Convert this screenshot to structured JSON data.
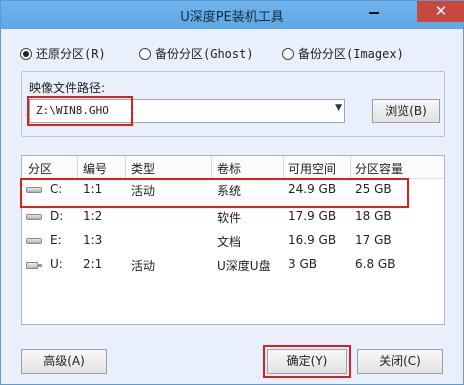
{
  "window": {
    "title": "U深度PE装机工具",
    "minimize_label": "—",
    "close_label": "✕"
  },
  "radios": [
    {
      "label": "还原分区(R)",
      "selected": true
    },
    {
      "label": "备份分区(Ghost)",
      "selected": false
    },
    {
      "label": "备份分区(Imagex)",
      "selected": false
    }
  ],
  "image_path": {
    "label": "映像文件路径:",
    "value": "Z:\\WIN8.GHO",
    "dropdown_icon": "chevron-down-icon",
    "browse_label": "浏览(B)"
  },
  "table": {
    "headers": [
      "分区",
      "编号",
      "类型",
      "卷标",
      "可用空间",
      "分区容量"
    ],
    "rows": [
      {
        "drive": "C:",
        "num": "1:1",
        "type": "活动",
        "label": "系统",
        "free": "24.9 GB",
        "size": "25 GB",
        "icon": "hard-drive-icon"
      },
      {
        "drive": "D:",
        "num": "1:2",
        "type": "",
        "label": "软件",
        "free": "17.9 GB",
        "size": "18 GB",
        "icon": "hard-drive-icon"
      },
      {
        "drive": "E:",
        "num": "1:3",
        "type": "",
        "label": "文档",
        "free": "16.9 GB",
        "size": "17 GB",
        "icon": "hard-drive-icon"
      },
      {
        "drive": "U:",
        "num": "2:1",
        "type": "活动",
        "label": "U深度U盘",
        "free": "3 GB",
        "size": "6.8 GB",
        "icon": "usb-drive-icon"
      }
    ]
  },
  "footer": {
    "advanced_label": "高级(A)",
    "ok_label": "确定(Y)",
    "close_label": "关闭(C)"
  },
  "colors": {
    "highlight": "#d9221c",
    "titlebar": "#5da6e5",
    "close": "#c9483d"
  }
}
